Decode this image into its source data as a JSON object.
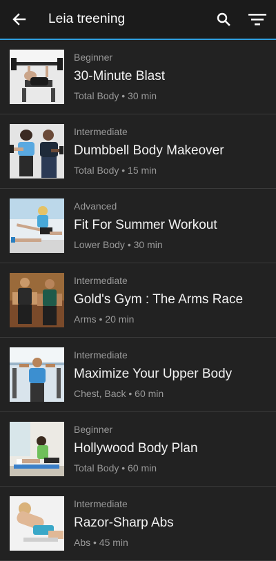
{
  "appbar": {
    "title": "Leia treening",
    "back_icon": "arrow-left-icon",
    "search_icon": "search-icon",
    "filter_icon": "filter-icon",
    "accent": "#2f9fe0"
  },
  "workouts": [
    {
      "level": "Beginner",
      "name": "30-Minute Blast",
      "meta": "Total Body • 30 min",
      "thumb": "bench-press-photo"
    },
    {
      "level": "Intermediate",
      "name": "Dumbbell Body Makeover",
      "meta": "Total Body • 15 min",
      "thumb": "dumbbell-couple-photo"
    },
    {
      "level": "Advanced",
      "name": "Fit For Summer Workout",
      "meta": "Lower Body • 30 min",
      "thumb": "stretch-photo"
    },
    {
      "level": "Intermediate",
      "name": "Gold's Gym : The Arms Race",
      "meta": "Arms • 20 min",
      "thumb": "arms-duo-photo"
    },
    {
      "level": "Intermediate",
      "name": "Maximize Your Upper Body",
      "meta": "Chest, Back • 60 min",
      "thumb": "upper-body-photo"
    },
    {
      "level": "Beginner",
      "name": "Hollywood Body Plan",
      "meta": "Total Body • 60 min",
      "thumb": "situp-photo"
    },
    {
      "level": "Intermediate",
      "name": "Razor-Sharp Abs",
      "meta": "Abs • 45 min",
      "thumb": "abs-crunch-photo"
    }
  ]
}
